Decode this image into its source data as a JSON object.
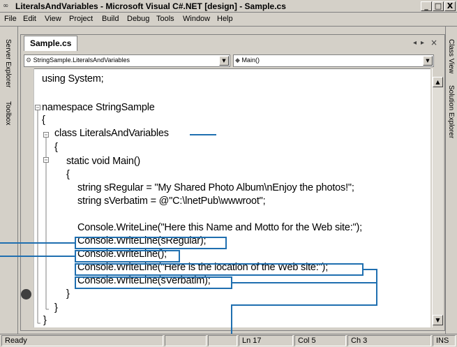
{
  "window": {
    "title": "LiteralsAndVariables - Microsoft Visual C#.NET [design] - Sample.cs",
    "controls": [
      "_",
      "□",
      "X"
    ]
  },
  "menu": [
    "File",
    "Edit",
    "View",
    "Project",
    "Build",
    "Debug",
    "Tools",
    "Window",
    "Help"
  ],
  "side_tabs": {
    "left": [
      "Server Explorer",
      "Toolbox"
    ],
    "right": [
      "Class View",
      "Solution Explorer"
    ]
  },
  "document": {
    "tab": "Sample.cs",
    "type_combo": "StringSample.LiteralsAndVariables",
    "member_combo": "Main()"
  },
  "code_lines": [
    "using System;",
    "namespace StringSample",
    "{",
    "class LiteralsAndVariables",
    "{",
    "static void Main()",
    "{",
    "string sRegular = \"My Shared Photo Album\\nEnjoy the photos!\";",
    "string sVerbatim = @\"C:\\lnetPub\\wwwroot\";",
    "Console.WriteLine(\"Here this Name and Motto for the Web site:\");",
    "Console.WriteLine(sRegular);",
    "Console.WriteLine();",
    "Console.WriteLine(\"Here is the location of the Web site:\");",
    "Console.WriteLine(sVerbatim);",
    "}",
    "}",
    "}"
  ],
  "status": {
    "ready": "Ready",
    "line": "Ln 17",
    "col": "Col 5",
    "ch": "Ch 3",
    "ins": "INS"
  },
  "colors": {
    "callout": "#1f6fb0",
    "breakpoint": "#404040"
  }
}
